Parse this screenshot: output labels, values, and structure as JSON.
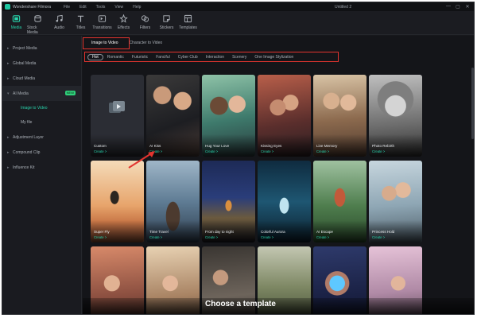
{
  "window": {
    "app_name": "Wondershare Filmora",
    "menu": [
      "File",
      "Edit",
      "Tools",
      "View",
      "Help"
    ],
    "document_title": "Untitled 2",
    "controls": [
      "—",
      "▢",
      "✕"
    ]
  },
  "toolbar": {
    "items": [
      {
        "label": "Media",
        "icon": "media-icon",
        "active": true
      },
      {
        "label": "Stock Media",
        "icon": "stock-media-icon",
        "active": false
      },
      {
        "label": "Audio",
        "icon": "audio-icon",
        "active": false
      },
      {
        "label": "Titles",
        "icon": "titles-icon",
        "active": false
      },
      {
        "label": "Transitions",
        "icon": "transitions-icon",
        "active": false
      },
      {
        "label": "Effects",
        "icon": "effects-icon",
        "active": false
      },
      {
        "label": "Filters",
        "icon": "filters-icon",
        "active": false
      },
      {
        "label": "Stickers",
        "icon": "stickers-icon",
        "active": false
      },
      {
        "label": "Templates",
        "icon": "templates-icon",
        "active": false
      }
    ]
  },
  "sidebar": {
    "items": [
      {
        "label": "Project Media"
      },
      {
        "label": "Global Media"
      },
      {
        "label": "Cloud Media"
      },
      {
        "label": "AI Media",
        "badge": "NEW"
      },
      {
        "label": "Adjustment Layer"
      },
      {
        "label": "Compound Clip"
      },
      {
        "label": "Influence Kit"
      }
    ],
    "sub_items": [
      {
        "label": "Image to Video",
        "selected": true
      },
      {
        "label": "My file",
        "selected": false
      }
    ]
  },
  "main": {
    "tabs": [
      {
        "label": "Image to Video",
        "active": true
      },
      {
        "label": "Character to Video",
        "active": false
      }
    ],
    "filters": [
      {
        "label": "Hot",
        "active": true
      },
      {
        "label": "Romantic",
        "active": false
      },
      {
        "label": "Futuristic",
        "active": false
      },
      {
        "label": "Fanciful",
        "active": false
      },
      {
        "label": "Cyber Club",
        "active": false
      },
      {
        "label": "Interaction",
        "active": false
      },
      {
        "label": "Scenery",
        "active": false
      },
      {
        "label": "One Image Stylization",
        "active": false
      }
    ],
    "cards": [
      {
        "title": "Custom",
        "cta": "Create >"
      },
      {
        "title": "AI Kiss",
        "cta": "Create >"
      },
      {
        "title": "Hug Your Love",
        "cta": "Create >"
      },
      {
        "title": "Kissing Eyes",
        "cta": "Create >"
      },
      {
        "title": "Live Memory",
        "cta": "Create >"
      },
      {
        "title": "Photo Rebirth",
        "cta": "Create >"
      },
      {
        "title": "Super Fly",
        "cta": "Create >"
      },
      {
        "title": "Time Travel",
        "cta": "Create >"
      },
      {
        "title": "From day to night",
        "cta": "Create >"
      },
      {
        "title": "Colorful Aurora",
        "cta": "Create >"
      },
      {
        "title": "AI Escape",
        "cta": "Create >"
      },
      {
        "title": "Princess Hold",
        "cta": "Create >"
      },
      {
        "title": "",
        "cta": ""
      },
      {
        "title": "",
        "cta": ""
      },
      {
        "title": "",
        "cta": ""
      },
      {
        "title": "",
        "cta": ""
      },
      {
        "title": "",
        "cta": ""
      },
      {
        "title": "",
        "cta": ""
      }
    ],
    "caption": "Choose a template"
  },
  "colors": {
    "accent": "#27d3ab",
    "highlight_box": "#e3342f",
    "background": "#141519"
  }
}
